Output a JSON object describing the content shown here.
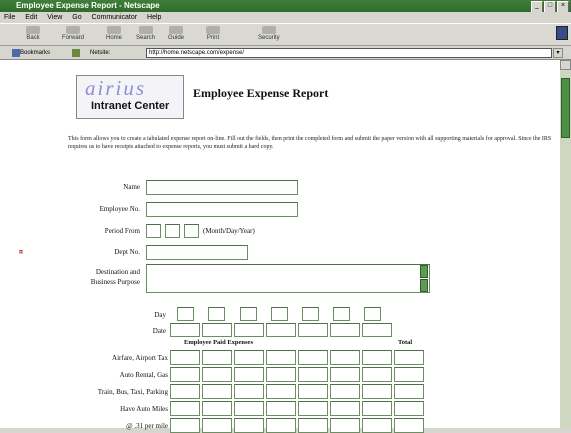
{
  "window": {
    "title": "Employee Expense Report - Netscape",
    "buttons": [
      "_",
      "□",
      "×"
    ]
  },
  "menu": [
    "File",
    "Edit",
    "View",
    "Go",
    "Communicator",
    "Help"
  ],
  "toolbar": [
    "Back",
    "Forward",
    "Home",
    "Search",
    "Guide",
    "Print",
    "Security"
  ],
  "location": {
    "bookmarks_label": "Bookmarks",
    "netsite_label": "Netsite:",
    "url": "http://home.netscape.com/expense/"
  },
  "logo": {
    "top": "airius",
    "bottom": "Intranet Center"
  },
  "page_title": "Employee Expense Report",
  "intro": "This form allows you to create a tabulated expense report on-line. Fill out the fields, then print the completed form and submit the paper version with all supporting materials for approval. Since the IRS requires us to have receipts attached to expense reports, you must submit a hard copy.",
  "form": {
    "name_label": "Name",
    "employee_no_label": "Employee No.",
    "period_from_label": "Period From",
    "period_hint": "(Month/Day/Year)",
    "dept_no_label": "Dept No.",
    "destination_label_1": "Destination and",
    "destination_label_2": "Business Purpose"
  },
  "expense_table": {
    "day_label": "Day",
    "date_label": "Date",
    "section_header": "Employee Paid Expenses",
    "total_header": "Total",
    "rows": [
      "Airfare, Airport Tax",
      "Auto Rental, Gas",
      "Train, Bus, Taxi, Parking",
      "Have Auto Miles",
      "@ .31 per mile"
    ]
  }
}
